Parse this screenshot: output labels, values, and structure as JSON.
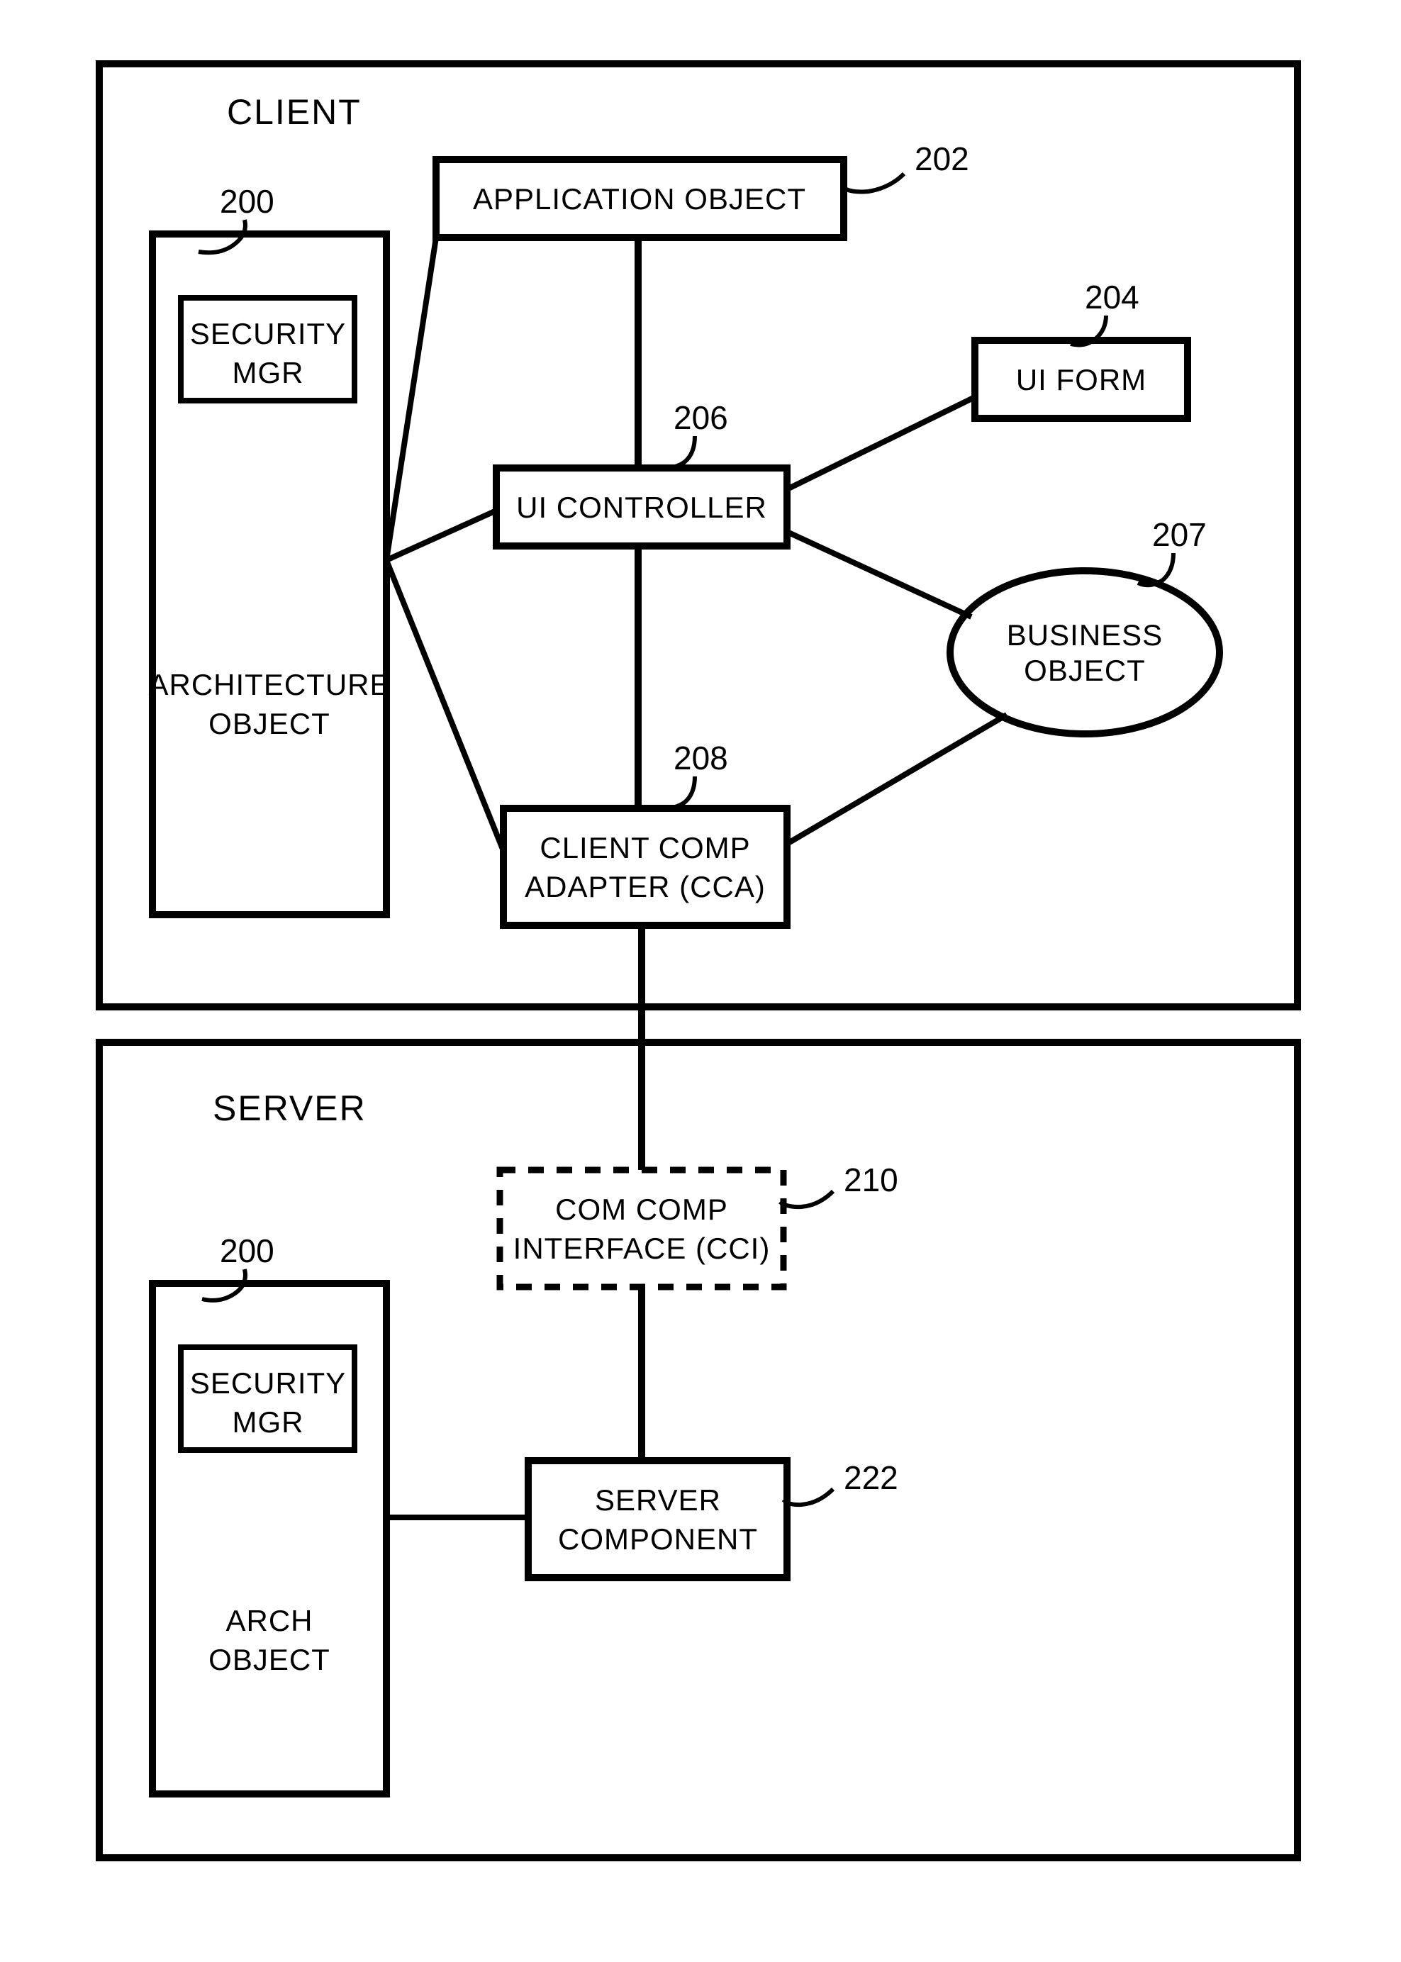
{
  "diagram": {
    "client_section_label": "CLIENT",
    "server_section_label": "SERVER",
    "nodes": {
      "arch_client": {
        "ref": "200",
        "security": "SECURITY",
        "security2": "MGR",
        "line1": "ARCHITECTURE",
        "line2": "OBJECT"
      },
      "app_object": {
        "ref": "202",
        "line1": "APPLICATION OBJECT"
      },
      "ui_form": {
        "ref": "204",
        "line1": "UI FORM"
      },
      "ui_controller": {
        "ref": "206",
        "line1": "UI CONTROLLER"
      },
      "business_object": {
        "ref": "207",
        "line1": "BUSINESS",
        "line2": "OBJECT"
      },
      "cca": {
        "ref": "208",
        "line1": "CLIENT COMP",
        "line2": "ADAPTER (CCA)"
      },
      "cci": {
        "ref": "210",
        "line1": "COM COMP",
        "line2": "INTERFACE (CCI)"
      },
      "arch_server": {
        "ref": "200",
        "security": "SECURITY",
        "security2": "MGR",
        "line1": "ARCH",
        "line2": "OBJECT"
      },
      "server_component": {
        "ref": "222",
        "line1": "SERVER",
        "line2": "COMPONENT"
      }
    }
  }
}
